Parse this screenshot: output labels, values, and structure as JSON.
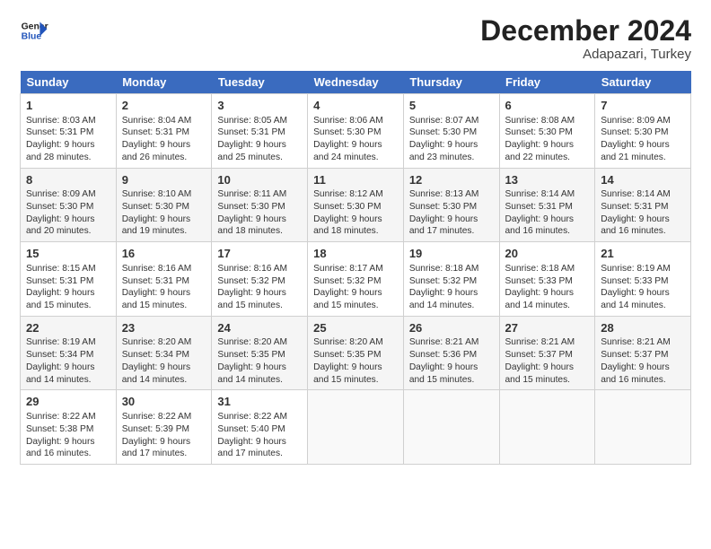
{
  "header": {
    "logo_line1": "General",
    "logo_line2": "Blue",
    "month": "December 2024",
    "location": "Adapazari, Turkey"
  },
  "days_of_week": [
    "Sunday",
    "Monday",
    "Tuesday",
    "Wednesday",
    "Thursday",
    "Friday",
    "Saturday"
  ],
  "weeks": [
    [
      {
        "num": "1",
        "lines": [
          "Sunrise: 8:03 AM",
          "Sunset: 5:31 PM",
          "Daylight: 9 hours",
          "and 28 minutes."
        ]
      },
      {
        "num": "2",
        "lines": [
          "Sunrise: 8:04 AM",
          "Sunset: 5:31 PM",
          "Daylight: 9 hours",
          "and 26 minutes."
        ]
      },
      {
        "num": "3",
        "lines": [
          "Sunrise: 8:05 AM",
          "Sunset: 5:31 PM",
          "Daylight: 9 hours",
          "and 25 minutes."
        ]
      },
      {
        "num": "4",
        "lines": [
          "Sunrise: 8:06 AM",
          "Sunset: 5:30 PM",
          "Daylight: 9 hours",
          "and 24 minutes."
        ]
      },
      {
        "num": "5",
        "lines": [
          "Sunrise: 8:07 AM",
          "Sunset: 5:30 PM",
          "Daylight: 9 hours",
          "and 23 minutes."
        ]
      },
      {
        "num": "6",
        "lines": [
          "Sunrise: 8:08 AM",
          "Sunset: 5:30 PM",
          "Daylight: 9 hours",
          "and 22 minutes."
        ]
      },
      {
        "num": "7",
        "lines": [
          "Sunrise: 8:09 AM",
          "Sunset: 5:30 PM",
          "Daylight: 9 hours",
          "and 21 minutes."
        ]
      }
    ],
    [
      {
        "num": "8",
        "lines": [
          "Sunrise: 8:09 AM",
          "Sunset: 5:30 PM",
          "Daylight: 9 hours",
          "and 20 minutes."
        ]
      },
      {
        "num": "9",
        "lines": [
          "Sunrise: 8:10 AM",
          "Sunset: 5:30 PM",
          "Daylight: 9 hours",
          "and 19 minutes."
        ]
      },
      {
        "num": "10",
        "lines": [
          "Sunrise: 8:11 AM",
          "Sunset: 5:30 PM",
          "Daylight: 9 hours",
          "and 18 minutes."
        ]
      },
      {
        "num": "11",
        "lines": [
          "Sunrise: 8:12 AM",
          "Sunset: 5:30 PM",
          "Daylight: 9 hours",
          "and 18 minutes."
        ]
      },
      {
        "num": "12",
        "lines": [
          "Sunrise: 8:13 AM",
          "Sunset: 5:30 PM",
          "Daylight: 9 hours",
          "and 17 minutes."
        ]
      },
      {
        "num": "13",
        "lines": [
          "Sunrise: 8:14 AM",
          "Sunset: 5:31 PM",
          "Daylight: 9 hours",
          "and 16 minutes."
        ]
      },
      {
        "num": "14",
        "lines": [
          "Sunrise: 8:14 AM",
          "Sunset: 5:31 PM",
          "Daylight: 9 hours",
          "and 16 minutes."
        ]
      }
    ],
    [
      {
        "num": "15",
        "lines": [
          "Sunrise: 8:15 AM",
          "Sunset: 5:31 PM",
          "Daylight: 9 hours",
          "and 15 minutes."
        ]
      },
      {
        "num": "16",
        "lines": [
          "Sunrise: 8:16 AM",
          "Sunset: 5:31 PM",
          "Daylight: 9 hours",
          "and 15 minutes."
        ]
      },
      {
        "num": "17",
        "lines": [
          "Sunrise: 8:16 AM",
          "Sunset: 5:32 PM",
          "Daylight: 9 hours",
          "and 15 minutes."
        ]
      },
      {
        "num": "18",
        "lines": [
          "Sunrise: 8:17 AM",
          "Sunset: 5:32 PM",
          "Daylight: 9 hours",
          "and 15 minutes."
        ]
      },
      {
        "num": "19",
        "lines": [
          "Sunrise: 8:18 AM",
          "Sunset: 5:32 PM",
          "Daylight: 9 hours",
          "and 14 minutes."
        ]
      },
      {
        "num": "20",
        "lines": [
          "Sunrise: 8:18 AM",
          "Sunset: 5:33 PM",
          "Daylight: 9 hours",
          "and 14 minutes."
        ]
      },
      {
        "num": "21",
        "lines": [
          "Sunrise: 8:19 AM",
          "Sunset: 5:33 PM",
          "Daylight: 9 hours",
          "and 14 minutes."
        ]
      }
    ],
    [
      {
        "num": "22",
        "lines": [
          "Sunrise: 8:19 AM",
          "Sunset: 5:34 PM",
          "Daylight: 9 hours",
          "and 14 minutes."
        ]
      },
      {
        "num": "23",
        "lines": [
          "Sunrise: 8:20 AM",
          "Sunset: 5:34 PM",
          "Daylight: 9 hours",
          "and 14 minutes."
        ]
      },
      {
        "num": "24",
        "lines": [
          "Sunrise: 8:20 AM",
          "Sunset: 5:35 PM",
          "Daylight: 9 hours",
          "and 14 minutes."
        ]
      },
      {
        "num": "25",
        "lines": [
          "Sunrise: 8:20 AM",
          "Sunset: 5:35 PM",
          "Daylight: 9 hours",
          "and 15 minutes."
        ]
      },
      {
        "num": "26",
        "lines": [
          "Sunrise: 8:21 AM",
          "Sunset: 5:36 PM",
          "Daylight: 9 hours",
          "and 15 minutes."
        ]
      },
      {
        "num": "27",
        "lines": [
          "Sunrise: 8:21 AM",
          "Sunset: 5:37 PM",
          "Daylight: 9 hours",
          "and 15 minutes."
        ]
      },
      {
        "num": "28",
        "lines": [
          "Sunrise: 8:21 AM",
          "Sunset: 5:37 PM",
          "Daylight: 9 hours",
          "and 16 minutes."
        ]
      }
    ],
    [
      {
        "num": "29",
        "lines": [
          "Sunrise: 8:22 AM",
          "Sunset: 5:38 PM",
          "Daylight: 9 hours",
          "and 16 minutes."
        ]
      },
      {
        "num": "30",
        "lines": [
          "Sunrise: 8:22 AM",
          "Sunset: 5:39 PM",
          "Daylight: 9 hours",
          "and 17 minutes."
        ]
      },
      {
        "num": "31",
        "lines": [
          "Sunrise: 8:22 AM",
          "Sunset: 5:40 PM",
          "Daylight: 9 hours",
          "and 17 minutes."
        ]
      },
      {
        "num": "",
        "lines": []
      },
      {
        "num": "",
        "lines": []
      },
      {
        "num": "",
        "lines": []
      },
      {
        "num": "",
        "lines": []
      }
    ]
  ]
}
